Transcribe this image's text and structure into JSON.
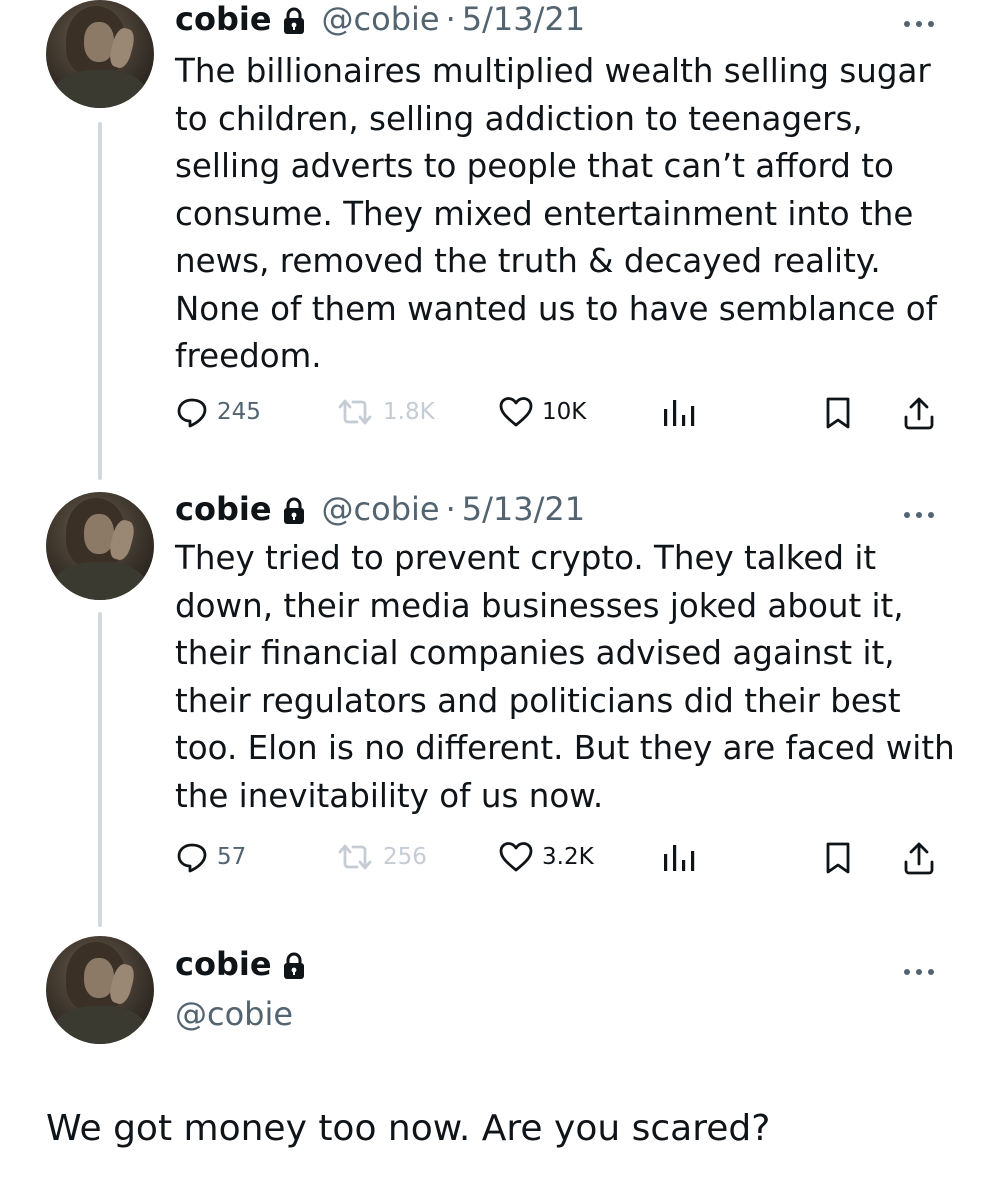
{
  "tweets": [
    {
      "name": "cobie",
      "handle": "@cobie",
      "separator": "·",
      "date": "5/13/21",
      "text": "The billionaires multiplied wealth selling sugar to children, selling addiction to teenagers, selling adverts to people that can’t afford to consume. They mixed entertainment into the news, removed the truth & decayed reality. None of them wanted us to have semblance of freedom.",
      "replies": "245",
      "retweets": "1.8K",
      "likes": "10K"
    },
    {
      "name": "cobie",
      "handle": "@cobie",
      "separator": "·",
      "date": "5/13/21",
      "text": "They tried to prevent crypto. They talked it down, their media businesses joked about it, their financial companies advised against it, their regulators and politicians did their best too. Elon is no different. But they are faced with the inevitability of us now.",
      "replies": "57",
      "retweets": "256",
      "likes": "3.2K"
    }
  ],
  "main_post": {
    "name": "cobie",
    "handle": "@cobie",
    "text": "We got money too now. Are you scared?"
  },
  "icons": {
    "lock": "lock-icon",
    "more": "more-icon",
    "reply": "reply-icon",
    "retweet": "retweet-icon",
    "like": "heart-icon",
    "views": "views-icon",
    "bookmark": "bookmark-icon",
    "share": "share-icon"
  },
  "colors": {
    "text": "#0f1419",
    "secondary": "#536471",
    "muted": "#c5ccd3",
    "thread_line": "#cfd9de"
  }
}
